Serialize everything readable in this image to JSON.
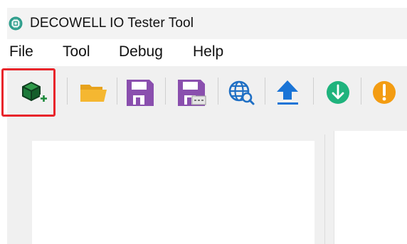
{
  "window": {
    "title": "DECOWELL IO Tester Tool",
    "app_icon": "chip-icon"
  },
  "menu": {
    "items": [
      {
        "label": "File"
      },
      {
        "label": "Tool"
      },
      {
        "label": "Debug"
      },
      {
        "label": "Help"
      }
    ]
  },
  "toolbar": {
    "buttons": [
      {
        "icon": "new-project-cube-icon",
        "highlighted": true
      },
      {
        "icon": "open-folder-icon"
      },
      {
        "icon": "save-icon"
      },
      {
        "icon": "save-as-icon"
      },
      {
        "icon": "network-search-icon"
      },
      {
        "icon": "upload-icon"
      },
      {
        "icon": "download-icon"
      },
      {
        "icon": "warning-icon"
      }
    ]
  },
  "colors": {
    "highlight": "#e8252b",
    "folder": "#f5b731",
    "save": "#8a4fae",
    "upload": "#1a74d6",
    "download": "#1fb37d",
    "warning": "#f39c12",
    "cube": "#1c7a3a"
  }
}
